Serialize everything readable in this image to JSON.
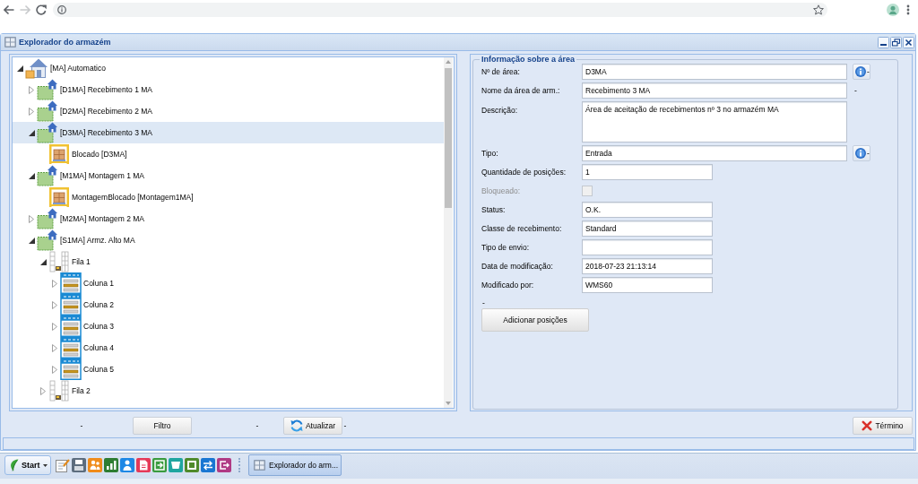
{
  "browser": {
    "nav_buttons": [
      {
        "kind": "back",
        "disabled": false
      },
      {
        "kind": "forward",
        "disabled": true
      },
      {
        "kind": "reload",
        "disabled": false
      }
    ]
  },
  "window": {
    "title": "Explorador do armazém"
  },
  "tree": {
    "items": [
      {
        "label": "[MA] Automatico",
        "kind": "warehouse",
        "expanded": true,
        "selected": false,
        "children": [
          {
            "label": "[D1MA] Recebimento 1 MA",
            "kind": "area",
            "expanded": false,
            "selected": false
          },
          {
            "label": "[D2MA] Recebimento 2 MA",
            "kind": "area",
            "expanded": false,
            "selected": false
          },
          {
            "label": "[D3MA] Recebimento 3 MA",
            "kind": "area",
            "expanded": true,
            "selected": true,
            "children": [
              {
                "label": "Blocado [D3MA]",
                "kind": "block",
                "selected": false
              }
            ]
          },
          {
            "label": "[M1MA] Montagem 1 MA",
            "kind": "area",
            "expanded": true,
            "selected": false,
            "children": [
              {
                "label": "MontagemBlocado [Montagem1MA]",
                "kind": "block",
                "selected": false
              }
            ]
          },
          {
            "label": "[M2MA] Montagem 2 MA",
            "kind": "area",
            "expanded": false,
            "selected": false
          },
          {
            "label": "[S1MA] Armz. Alto MA",
            "kind": "area",
            "expanded": true,
            "selected": false,
            "children": [
              {
                "label": "Fila 1",
                "kind": "row",
                "expanded": true,
                "selected": false,
                "children": [
                  {
                    "label": "Coluna 1",
                    "kind": "column",
                    "expanded": false,
                    "selected": false
                  },
                  {
                    "label": "Coluna 2",
                    "kind": "column",
                    "expanded": false,
                    "selected": false
                  },
                  {
                    "label": "Coluna 3",
                    "kind": "column",
                    "expanded": false,
                    "selected": false
                  },
                  {
                    "label": "Coluna 4",
                    "kind": "column",
                    "expanded": false,
                    "selected": false
                  },
                  {
                    "label": "Coluna 5",
                    "kind": "column",
                    "expanded": false,
                    "selected": false
                  }
                ]
              },
              {
                "label": "Fila 2",
                "kind": "row",
                "expanded": false,
                "selected": false
              }
            ]
          }
        ]
      }
    ]
  },
  "form": {
    "legend": "Informação sobre a área",
    "fields": [
      {
        "label": "Nº de área:",
        "kind": "wide",
        "value": "D3MA",
        "action": {
          "kind": "info",
          "text": "-"
        }
      },
      {
        "label": "Nome da área de arm.:",
        "kind": "wide",
        "value": "Recebimento 3 MA",
        "suffix": "-"
      },
      {
        "label": "Descrição:",
        "kind": "textarea",
        "value": "Área de aceitação de recebimentos nº 3 no armazém MA"
      },
      {
        "label": "Tipo:",
        "kind": "wide",
        "value": "Entrada",
        "action": {
          "kind": "info",
          "text": "-"
        }
      },
      {
        "label": "Quantidade de posições:",
        "kind": "short",
        "value": "1"
      },
      {
        "label": "Bloqueado:",
        "kind": "checkbox",
        "checked": false,
        "disabled": true
      },
      {
        "label": "Status:",
        "kind": "short",
        "value": "O.K."
      },
      {
        "label": "Classe de recebimento:",
        "kind": "short",
        "value": "Standard"
      },
      {
        "label": "Tipo de envio:",
        "kind": "short"
      },
      {
        "label": "Data de modificação:",
        "kind": "short",
        "value": "2018-07-23 21:13:14"
      },
      {
        "label": "Modificado por:",
        "kind": "short",
        "value": "WMS60"
      }
    ],
    "note": "-",
    "button": "Adicionar posições"
  },
  "toolbar": {
    "left": [
      {
        "kind": "dash",
        "text": "-"
      },
      {
        "kind": "button",
        "text": "Filtro"
      },
      {
        "kind": "dash",
        "text": "-"
      },
      {
        "kind": "refresh_button",
        "text": "Atualizar"
      },
      {
        "kind": "dash",
        "text": "-"
      }
    ],
    "right": [
      {
        "kind": "close_button",
        "text": "Término"
      }
    ]
  },
  "taskbar": {
    "start": "Start",
    "tasks": [
      {
        "title": "Explorador do arm...",
        "selected": true
      }
    ]
  }
}
